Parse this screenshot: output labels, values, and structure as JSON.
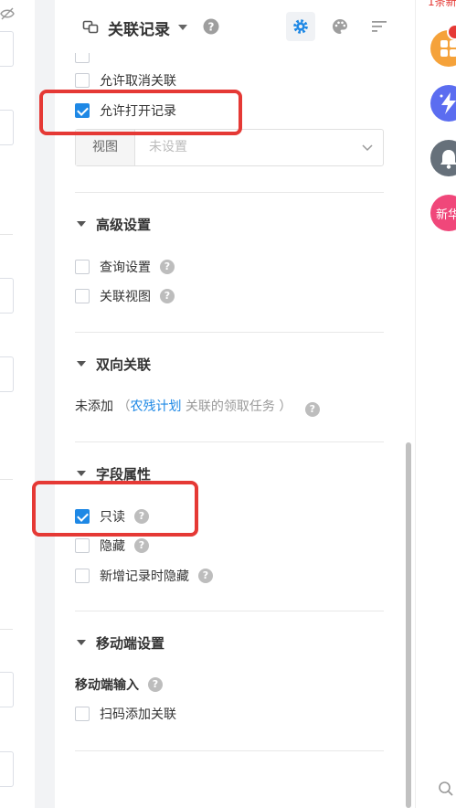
{
  "header": {
    "title": "关联记录",
    "help": "?"
  },
  "options_top": {
    "allow_unlink": "允许取消关联",
    "allow_open": "允许打开记录"
  },
  "view_select": {
    "label": "视图",
    "value": "未设置"
  },
  "sections": {
    "advanced": {
      "title": "高级设置",
      "query_settings": "查询设置",
      "related_view": "关联视图"
    },
    "two_way": {
      "title": "双向关联",
      "prefix": "未添加",
      "paren_open": "（",
      "link": "农残计划",
      "suffix": "关联的领取任务",
      "paren_close": "）"
    },
    "field_props": {
      "title": "字段属性",
      "readonly": "只读",
      "hidden": "隐藏",
      "hide_on_new": "新增记录时隐藏"
    },
    "mobile": {
      "title": "移动端设置",
      "input_label": "移动端输入",
      "scan_add": "扫码添加关联"
    }
  },
  "checkbox_states": {
    "allow_unlink": false,
    "allow_open": true,
    "query_settings": false,
    "related_view": false,
    "readonly": true,
    "hidden": false,
    "hide_on_new": false,
    "scan_add": false
  },
  "right_rail": {
    "top_text": "1条新",
    "new_label": "新华"
  },
  "colors": {
    "accent": "#1e88e5",
    "highlight": "#e53935",
    "apps_orange": "#f5a23a",
    "ai_blue": "#5b6df0",
    "bell_gray": "#66707a",
    "new_pink": "#f0477a"
  }
}
